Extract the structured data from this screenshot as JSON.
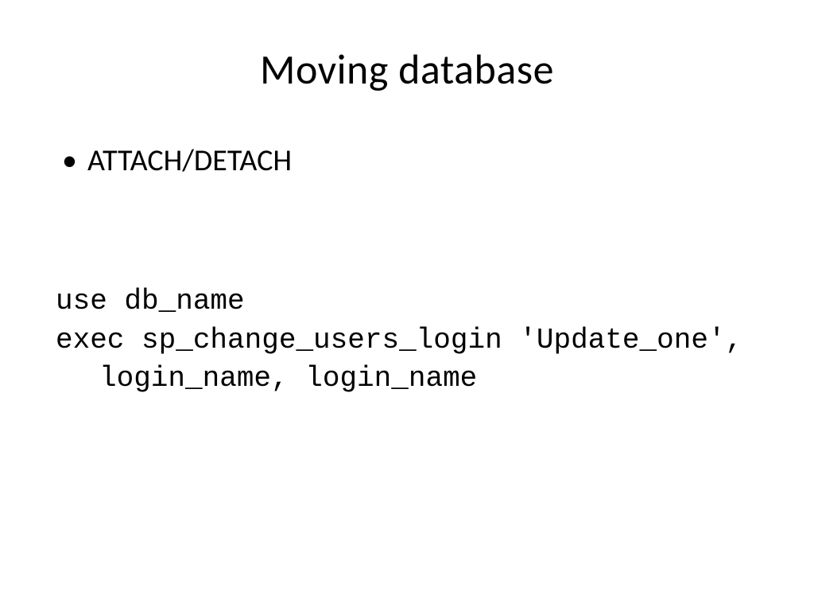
{
  "slide": {
    "title": "Moving database",
    "bullets": [
      "ATTACH/DETACH"
    ],
    "code": {
      "line1": "use db_name",
      "line2": "exec sp_change_users_login 'Update_one', login_name, login_name"
    }
  }
}
